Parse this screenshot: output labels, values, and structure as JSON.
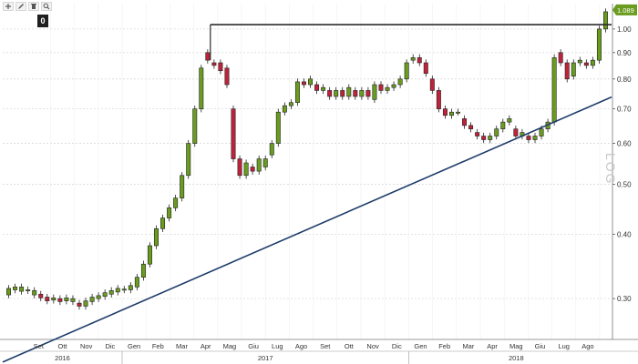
{
  "toolbar": {
    "icons": [
      "plus-icon",
      "pencil-icon",
      "trash-icon",
      "magnifier-icon"
    ],
    "badge": "0"
  },
  "watermark": "LOG",
  "colors": {
    "up": "#6a9c1f",
    "down": "#c0223b",
    "trendline": "#1f3d6b",
    "resistance": "#2b2b2b",
    "grid": "#d9d9d9",
    "price_tag": "#6a9c1f"
  },
  "chart_data": {
    "type": "candlestick",
    "y_scale": "log",
    "ylim": [
      0.25,
      1.12
    ],
    "y_ticks": [
      "0.30",
      "0.40",
      "0.50",
      "0.60",
      "0.70",
      "0.80",
      "0.90",
      "1.00"
    ],
    "x_ticks": [
      "Set",
      "Ott",
      "Nov",
      "Dic",
      "Gen",
      "Feb",
      "Mar",
      "Apr",
      "Mag",
      "Giu",
      "Lug",
      "Ago",
      "Set",
      "Ott",
      "Nov",
      "Dic",
      "Gen",
      "Feb",
      "Mar",
      "Apr",
      "Mag",
      "Giu",
      "Lug",
      "Ago"
    ],
    "years": [
      "2016",
      "2017",
      "2018"
    ],
    "last_price": "1.089",
    "resistance": {
      "start": "2017-05",
      "level": 1.02
    },
    "trendline": {
      "start": [
        "2016-08",
        0.226
      ],
      "end": [
        "2018-09",
        0.738
      ]
    },
    "candles": [
      [
        0.305,
        0.314
      ],
      [
        0.312,
        0.316
      ],
      [
        0.31,
        0.316
      ],
      [
        0.311,
        0.312
      ],
      [
        0.305,
        0.311
      ],
      [
        0.306,
        0.301
      ],
      [
        0.302,
        0.297
      ],
      [
        0.298,
        0.301
      ],
      [
        0.3,
        0.296
      ],
      [
        0.297,
        0.301
      ],
      [
        0.296,
        0.3
      ],
      [
        0.294,
        0.29
      ],
      [
        0.29,
        0.297
      ],
      [
        0.296,
        0.302
      ],
      [
        0.3,
        0.304
      ],
      [
        0.303,
        0.308
      ],
      [
        0.306,
        0.311
      ],
      [
        0.309,
        0.314
      ],
      [
        0.312,
        0.313
      ],
      [
        0.312,
        0.318
      ],
      [
        0.316,
        0.33
      ],
      [
        0.33,
        0.35
      ],
      [
        0.35,
        0.38
      ],
      [
        0.38,
        0.41
      ],
      [
        0.41,
        0.43
      ],
      [
        0.43,
        0.45
      ],
      [
        0.45,
        0.47
      ],
      [
        0.47,
        0.52
      ],
      [
        0.52,
        0.6
      ],
      [
        0.6,
        0.7
      ],
      [
        0.7,
        0.84
      ],
      [
        0.9,
        0.87
      ],
      [
        0.86,
        0.85
      ],
      [
        0.86,
        0.83
      ],
      [
        0.84,
        0.78
      ],
      [
        0.7,
        0.56
      ],
      [
        0.56,
        0.52
      ],
      [
        0.52,
        0.55
      ],
      [
        0.54,
        0.53
      ],
      [
        0.53,
        0.56
      ],
      [
        0.54,
        0.56
      ],
      [
        0.57,
        0.6
      ],
      [
        0.6,
        0.69
      ],
      [
        0.69,
        0.71
      ],
      [
        0.71,
        0.72
      ],
      [
        0.72,
        0.79
      ],
      [
        0.79,
        0.78
      ],
      [
        0.78,
        0.8
      ],
      [
        0.78,
        0.76
      ],
      [
        0.76,
        0.77
      ],
      [
        0.76,
        0.74
      ],
      [
        0.74,
        0.76
      ],
      [
        0.76,
        0.74
      ],
      [
        0.74,
        0.77
      ],
      [
        0.76,
        0.74
      ],
      [
        0.74,
        0.76
      ],
      [
        0.76,
        0.74
      ],
      [
        0.73,
        0.78
      ],
      [
        0.78,
        0.76
      ],
      [
        0.76,
        0.77
      ],
      [
        0.77,
        0.78
      ],
      [
        0.78,
        0.8
      ],
      [
        0.8,
        0.86
      ],
      [
        0.87,
        0.88
      ],
      [
        0.88,
        0.86
      ],
      [
        0.86,
        0.82
      ],
      [
        0.8,
        0.76
      ],
      [
        0.76,
        0.7
      ],
      [
        0.7,
        0.68
      ],
      [
        0.68,
        0.69
      ],
      [
        0.69,
        0.69
      ],
      [
        0.67,
        0.65
      ],
      [
        0.65,
        0.64
      ],
      [
        0.63,
        0.62
      ],
      [
        0.62,
        0.61
      ],
      [
        0.61,
        0.62
      ],
      [
        0.62,
        0.64
      ],
      [
        0.64,
        0.66
      ],
      [
        0.66,
        0.67
      ],
      [
        0.64,
        0.62
      ],
      [
        0.62,
        0.63
      ],
      [
        0.62,
        0.61
      ],
      [
        0.61,
        0.62
      ],
      [
        0.62,
        0.64
      ],
      [
        0.64,
        0.66
      ],
      [
        0.66,
        0.88
      ],
      [
        0.9,
        0.86
      ],
      [
        0.86,
        0.8
      ],
      [
        0.81,
        0.86
      ],
      [
        0.86,
        0.87
      ],
      [
        0.86,
        0.85
      ],
      [
        0.85,
        0.87
      ],
      [
        0.87,
        1.0
      ],
      [
        1.0,
        1.08
      ]
    ]
  }
}
